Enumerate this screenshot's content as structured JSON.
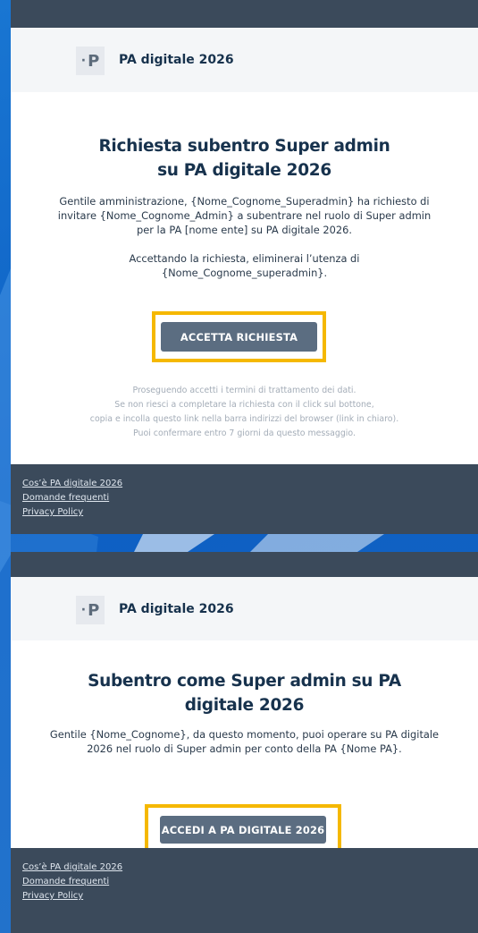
{
  "brand": {
    "logo_letter": "P",
    "logo_dot": "·",
    "name": "PA digitale 2026"
  },
  "email1": {
    "title": "Richiesta subentro Super admin su PA digitale 2026",
    "paragraph1": "Gentile amministrazione, {Nome_Cognome_Superadmin} ha richiesto di invitare {Nome_Cognome_Admin} a subentrare nel ruolo di Super admin per la PA [nome ente] su PA digitale 2026.",
    "paragraph2": "Accettando la richiesta, eliminerai l’utenza di {Nome_Cognome_superadmin}.",
    "button": "ACCETTA RICHIESTA",
    "note": [
      "Proseguendo accetti i termini di trattamento dei dati.",
      "Se non riesci a completare la richiesta con il click sul bottone,",
      "copia e incolla questo link nella barra indirizzi del browser (link in chiaro).",
      "Puoi confermare entro 7 giorni da questo messaggio."
    ]
  },
  "email2": {
    "title": "Subentro come Super admin su PA digitale 2026",
    "paragraph1": "Gentile {Nome_Cognome}, da questo momento, puoi operare su PA digitale 2026 nel ruolo di Super admin per conto della PA {Nome PA}.",
    "button": "ACCEDI A PA DIGITALE 2026"
  },
  "footer": {
    "links": [
      "Cos’è PA digitale 2026",
      "Domande frequenti",
      "Privacy Policy"
    ]
  },
  "colors": {
    "background": "#1565c0",
    "header": "#3b4a5b",
    "button": "#5b6d81",
    "highlight": "#f5b800",
    "title": "#17324d"
  }
}
